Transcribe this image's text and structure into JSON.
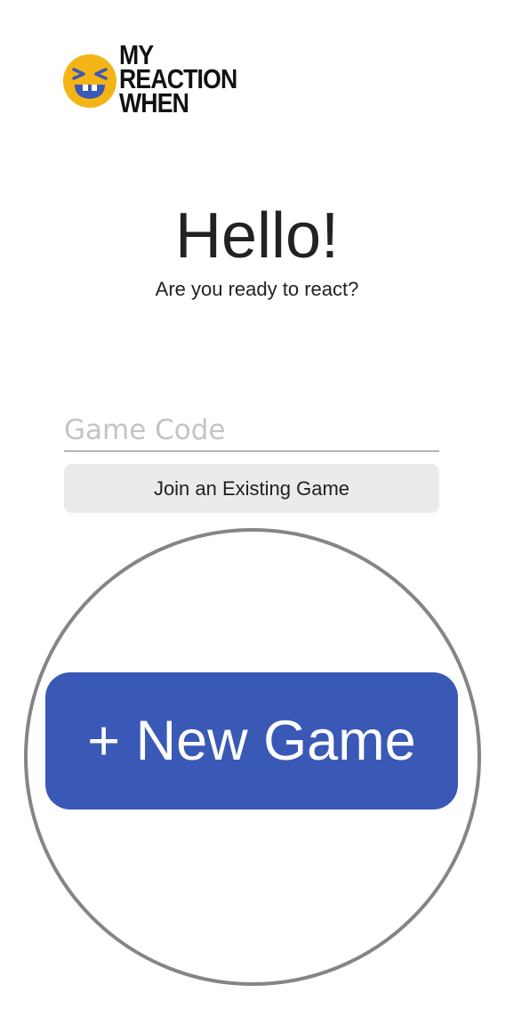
{
  "logo": {
    "line1": "MY",
    "line2": "REACTION",
    "line3": "WHEN",
    "icon": "laughing-face-icon",
    "icon_color": "#f5b416",
    "icon_mouth_color": "#3a59b6"
  },
  "hero": {
    "title": "Hello!",
    "subtitle": "Are you ready to react?"
  },
  "game_code": {
    "placeholder": "Game Code",
    "value": ""
  },
  "join_button": {
    "label": "Join an Existing Game"
  },
  "new_game_button": {
    "label": "+ New Game",
    "color": "#3a59b6"
  }
}
